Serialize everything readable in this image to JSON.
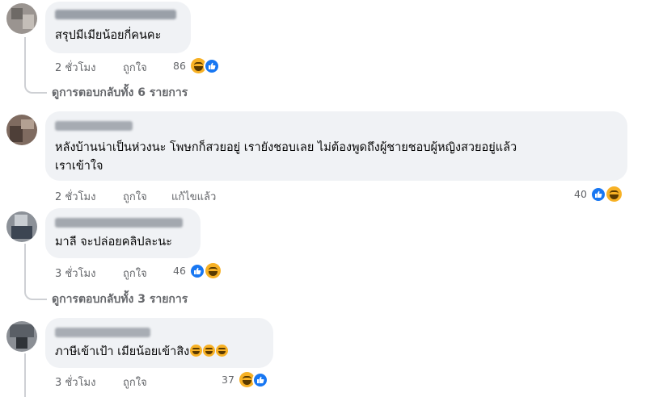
{
  "comments": [
    {
      "text_lines": [
        "สรุปมีเมียน้อยกี่คนคะ"
      ],
      "time": "2 ชั่วโมง",
      "like_label": "ถูกใจ",
      "edited_label": "",
      "reaction_count": "86",
      "reactions": [
        "laugh-icon",
        "like-icon"
      ],
      "view_replies": "ดูการตอบกลับทั้ง 6 รายการ"
    },
    {
      "text_lines": [
        "หลังบ้านน่าเป็นห่วงนะ โพษกก็สวยอยู่ เรายังชอบเลย ไม่ต้องพูดถึงผู้ชายชอบผู้หญิงสวยอยู่แล้ว",
        "เราเข้าใจ"
      ],
      "time": "2 ชั่วโมง",
      "like_label": "ถูกใจ",
      "edited_label": "แก้ไขแล้ว",
      "reaction_count": "40",
      "reactions": [
        "like-icon",
        "laugh-icon"
      ],
      "view_replies": ""
    },
    {
      "text_lines": [
        "มาลี จะปล่อยคลิปละนะ"
      ],
      "time": "3 ชั่วโมง",
      "like_label": "ถูกใจ",
      "edited_label": "",
      "reaction_count": "46",
      "reactions": [
        "like-icon",
        "laugh-icon"
      ],
      "view_replies": "ดูการตอบกลับทั้ง 3 รายการ"
    },
    {
      "text_lines": [
        "ภาษีเข้าเป้า เมียน้อยเข้าสิง"
      ],
      "time": "3 ชั่วโมง",
      "like_label": "ถูกใจ",
      "edited_label": "",
      "reaction_count": "37",
      "reactions": [
        "laugh-icon",
        "like-icon"
      ],
      "view_replies": ""
    }
  ],
  "colors": {
    "bubble": "#f0f2f5",
    "meta": "#65676b",
    "like_blue": "#1877f2",
    "laugh_yellow": "#f7b125"
  }
}
